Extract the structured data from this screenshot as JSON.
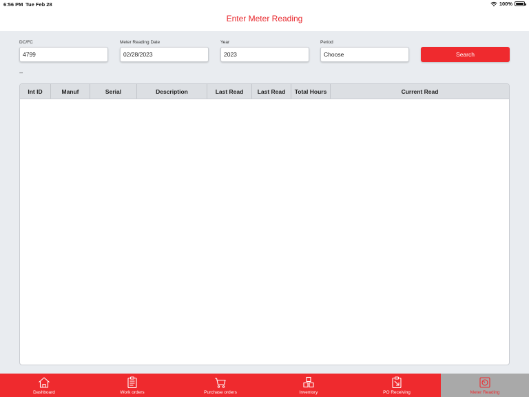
{
  "status_bar": {
    "time": "6:56 PM",
    "date": "Tue Feb 28",
    "battery": "100%"
  },
  "header": {
    "title": "Enter Meter Reading"
  },
  "form": {
    "dcfc": {
      "label": "DC/FC",
      "value": "4799"
    },
    "meter_date": {
      "label": "Meter Reading Date",
      "value": "02/28/2023"
    },
    "year": {
      "label": "Year",
      "value": "2023"
    },
    "period": {
      "label": "Period",
      "value": "Choose"
    },
    "search_label": "Search",
    "status_text": "--"
  },
  "table": {
    "columns": [
      "Int ID",
      "Manuf",
      "Serial",
      "Description",
      "Last Read",
      "Last Read",
      "Total Hours",
      "Current Read"
    ]
  },
  "tabs": [
    {
      "label": "Dashboard",
      "icon": "home-icon"
    },
    {
      "label": "Work orders",
      "icon": "clipboard-icon"
    },
    {
      "label": "Purchase orders",
      "icon": "cart-icon"
    },
    {
      "label": "Inventory",
      "icon": "boxes-icon"
    },
    {
      "label": "PO Receiving",
      "icon": "receiving-icon"
    },
    {
      "label": "Meter Reading",
      "icon": "meter-icon",
      "active": true
    }
  ],
  "colors": {
    "brand_red": "#ef2a2e",
    "active_tab_bg": "#a9a9a9"
  }
}
